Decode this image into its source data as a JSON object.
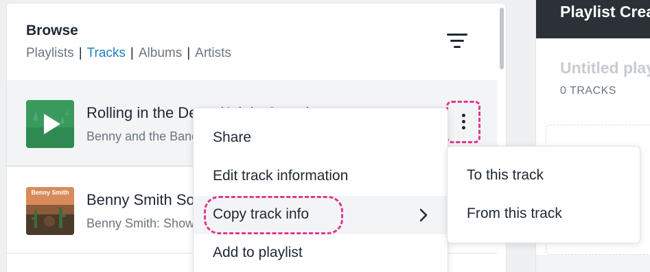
{
  "browse": {
    "title": "Browse",
    "tabs": [
      {
        "label": "Playlists",
        "active": false
      },
      {
        "label": "Tracks",
        "active": true
      },
      {
        "label": "Albums",
        "active": false
      },
      {
        "label": "Artists",
        "active": false
      }
    ],
    "separator": "|"
  },
  "tracks": [
    {
      "title": "Rolling in the Deep (Adele Cover)",
      "subtitle": "Benny and the Band"
    },
    {
      "title": "Benny Smith Songs",
      "subtitle": "Benny Smith: Shows"
    }
  ],
  "thumbnail2": {
    "text": "Benny Smith"
  },
  "context_menu": {
    "items": [
      {
        "label": "Share"
      },
      {
        "label": "Edit track information"
      },
      {
        "label": "Copy track info"
      },
      {
        "label": "Add to playlist"
      }
    ]
  },
  "submenu": {
    "items": [
      {
        "label": "To this track"
      },
      {
        "label": "From this track"
      }
    ]
  },
  "playlist_panel": {
    "title": "Playlist Creator",
    "name": "Untitled playlist",
    "count": "0 TRACKS"
  },
  "colors": {
    "accent": "#1b80c4",
    "highlight": "#e0368e",
    "header_dark": "#2b3137"
  },
  "icons": {
    "filter": "filter-icon",
    "more": "more-vertical-icon",
    "chevron": "chevron-right-icon",
    "play": "play-icon"
  }
}
